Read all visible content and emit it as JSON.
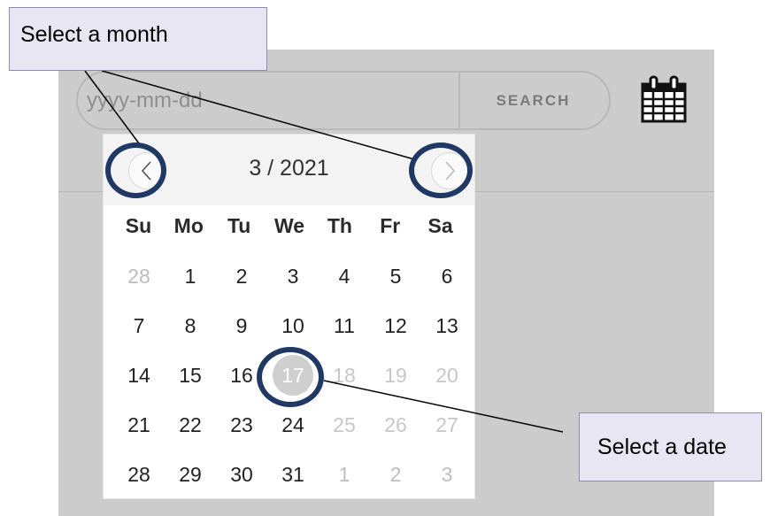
{
  "search": {
    "placeholder": "yyyy-mm-dd",
    "button_label": "SEARCH"
  },
  "datepicker": {
    "month_label": "3 / 2021",
    "weekdays": [
      "Su",
      "Mo",
      "Tu",
      "We",
      "Th",
      "Fr",
      "Sa"
    ],
    "weeks": [
      [
        "28",
        "1",
        "2",
        "3",
        "4",
        "5",
        "6"
      ],
      [
        "7",
        "8",
        "9",
        "10",
        "11",
        "12",
        "13"
      ],
      [
        "14",
        "15",
        "16",
        "17",
        "18",
        "19",
        "20"
      ],
      [
        "21",
        "22",
        "23",
        "24",
        "25",
        "26",
        "27"
      ],
      [
        "28",
        "29",
        "30",
        "31",
        "1",
        "2",
        "3"
      ]
    ],
    "selected_date": "17"
  },
  "callouts": {
    "month": "Select a month",
    "date": "Select a date",
    "ring_color": "#1f3864",
    "box_color": "#e8e6f3"
  },
  "icons": {
    "calendar": "calendar-icon",
    "prev": "chevron-left-icon",
    "next": "chevron-right-icon"
  }
}
